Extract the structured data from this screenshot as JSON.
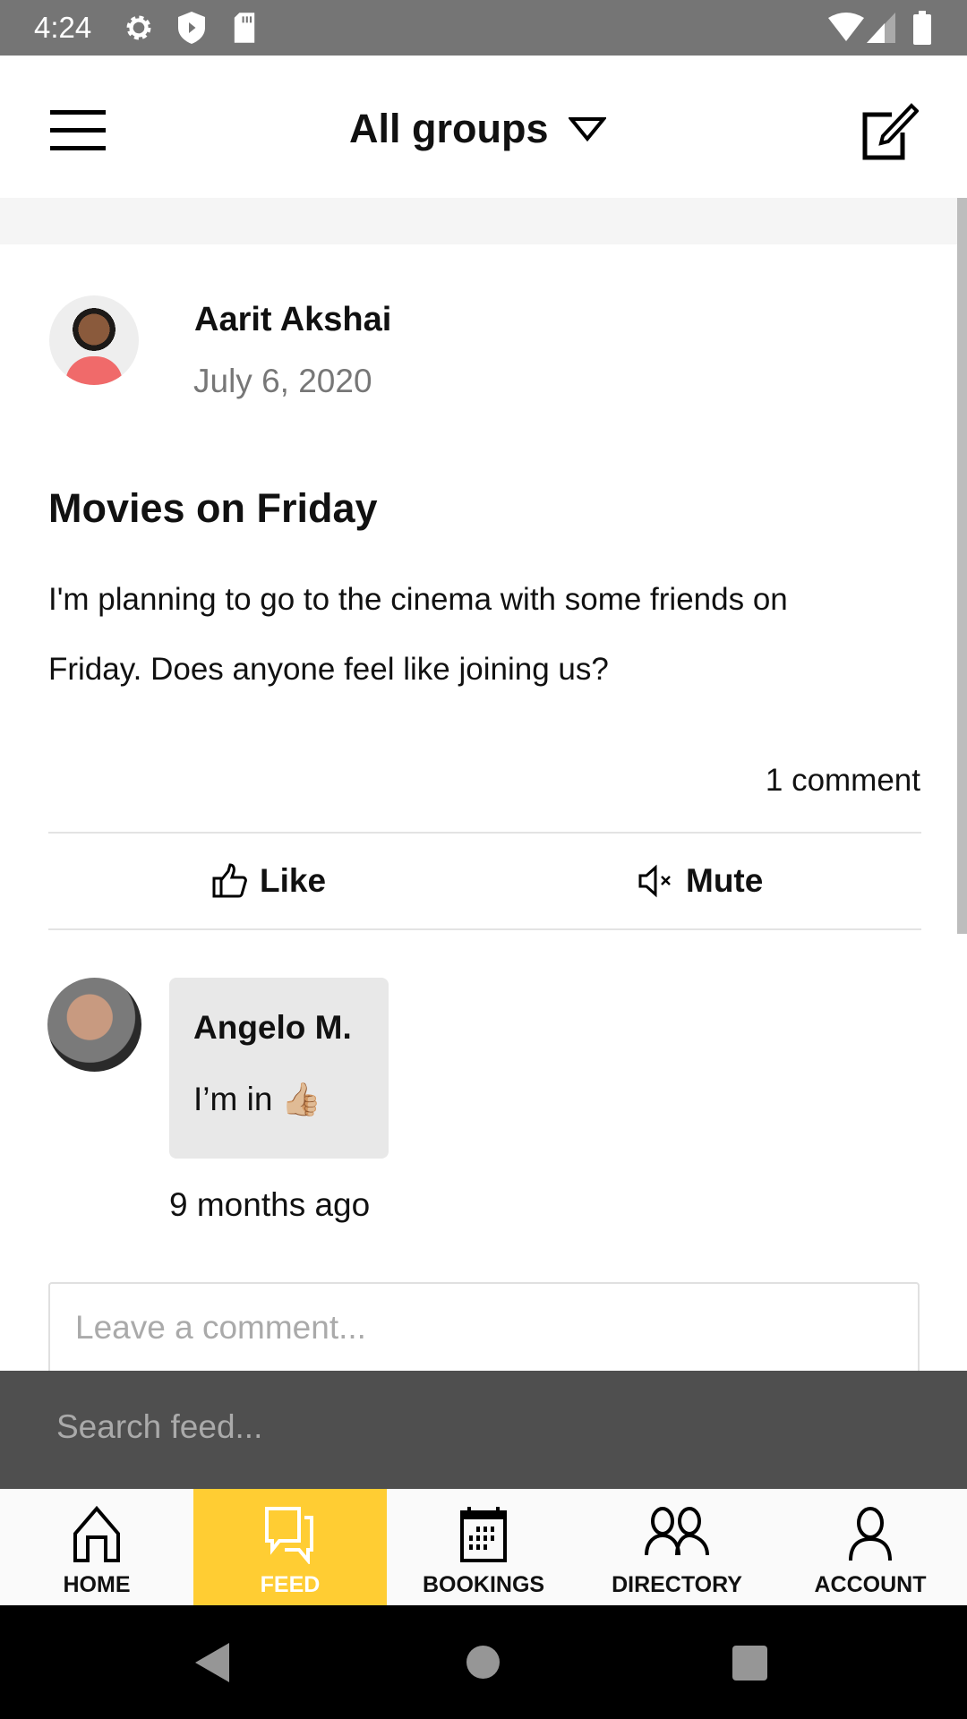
{
  "status_bar": {
    "time": "4:24",
    "icons": [
      "gear-icon",
      "shield-icon",
      "sd-card-icon",
      "wifi-icon",
      "signal-icon",
      "battery-icon"
    ]
  },
  "header": {
    "title": "All groups",
    "menu_icon": "hamburger-icon",
    "dropdown_icon": "triangle-down-icon",
    "compose_icon": "compose-icon"
  },
  "post": {
    "author": "Aarit Akshai",
    "date": "July 6, 2020",
    "title": "Movies on Friday",
    "body_line1": "I'm planning to go to the cinema with some friends on",
    "body_line2": "Friday. Does anyone feel like joining us?",
    "comment_count": "1 comment",
    "like_label": "Like",
    "mute_label": "Mute"
  },
  "comment": {
    "author": "Angelo M.",
    "text": "I’m in",
    "emoji": "👍🏼",
    "time": "9 months ago"
  },
  "comment_input": {
    "placeholder": "Leave a comment..."
  },
  "search": {
    "placeholder": "Search feed..."
  },
  "nav": {
    "items": [
      {
        "label": "HOME"
      },
      {
        "label": "FEED"
      },
      {
        "label": "BOOKINGS"
      },
      {
        "label": "DIRECTORY"
      },
      {
        "label": "ACCOUNT"
      }
    ],
    "active": "FEED"
  },
  "colors": {
    "accent": "#ffcd33",
    "status_bar": "#757575",
    "search_bar": "#4f4f4f"
  }
}
